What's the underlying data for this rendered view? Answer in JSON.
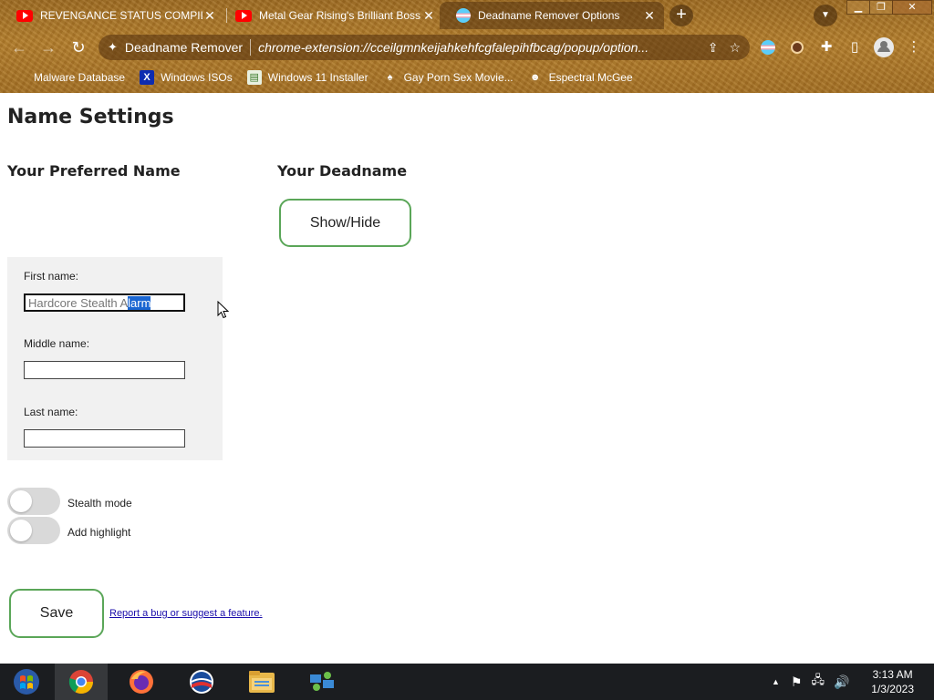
{
  "browser": {
    "tabs": [
      {
        "title": "REVENGANCE STATUS COMPIL",
        "icon": "youtube-icon"
      },
      {
        "title": "Metal Gear Rising's Brilliant Boss",
        "icon": "youtube-icon"
      },
      {
        "title": "Deadname Remover Options",
        "icon": "trans-flag-icon"
      }
    ],
    "omnibox_site": "Deadname Remover",
    "omnibox_url": "chrome-extension://cceilgmnkeijahkehfcgfalepihfbcag/popup/option...",
    "bookmarks": [
      {
        "label": "Malware Database",
        "icon": "globe-icon"
      },
      {
        "label": "Windows ISOs",
        "icon": "x-logo-icon"
      },
      {
        "label": "Windows 11 Installer",
        "icon": "document-icon"
      },
      {
        "label": "Gay Porn Sex Movie...",
        "icon": "spade-icon"
      },
      {
        "label": "Espectral McGee",
        "icon": "character-icon"
      }
    ]
  },
  "page": {
    "title": "Name Settings",
    "preferred_heading": "Your Preferred Name",
    "deadname_heading": "Your Deadname",
    "show_hide_label": "Show/Hide",
    "fields": {
      "first_label": "First name:",
      "first_value_plain": "Hardcore Stealth A",
      "first_value_selected": "larm",
      "middle_label": "Middle name:",
      "middle_value": "",
      "last_label": "Last name:",
      "last_value": ""
    },
    "toggles": {
      "stealth_label": "Stealth mode",
      "stealth_on": false,
      "highlight_label": "Add highlight",
      "highlight_on": false
    },
    "save_label": "Save",
    "report_link": "Report a bug or suggest a feature."
  },
  "taskbar": {
    "time": "3:13 AM",
    "date": "1/3/2023"
  },
  "colors": {
    "accent_border": "#5aa658",
    "selection": "#1a66d2",
    "panel": "#f1f1f1",
    "toggle_off": "#d9d9d9"
  }
}
